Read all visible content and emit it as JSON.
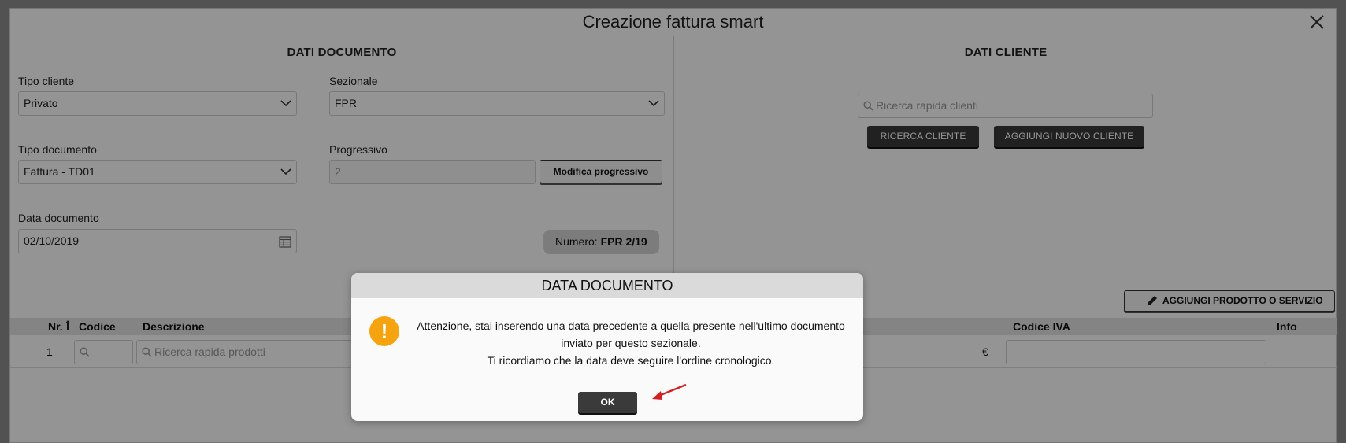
{
  "window": {
    "title": "Creazione fattura smart",
    "close_icon": "close-icon"
  },
  "dati_documento": {
    "title": "DATI DOCUMENTO",
    "tipo_cliente": {
      "label": "Tipo cliente",
      "value": "Privato"
    },
    "sezionale": {
      "label": "Sezionale",
      "value": "FPR"
    },
    "tipo_documento": {
      "label": "Tipo documento",
      "value": "Fattura - TD01"
    },
    "progressivo": {
      "label": "Progressivo",
      "value": "2",
      "button": "Modifica progressivo"
    },
    "data_documento": {
      "label": "Data documento",
      "value": "02/10/2019"
    },
    "numero": {
      "label": "Numero:",
      "value": "FPR 2/19"
    }
  },
  "dati_cliente": {
    "title": "DATI CLIENTE",
    "search_placeholder": "Ricerca rapida clienti",
    "ricerca_button": "RICERCA CLIENTE",
    "aggiungi_button": "AGGIUNGI NUOVO CLIENTE"
  },
  "products": {
    "add_button": "AGGIUNGI PRODOTTO O SERVIZIO",
    "columns": {
      "nr": "Nr.",
      "codice": "Codice",
      "descrizione": "Descrizione",
      "codice_iva": "Codice IVA",
      "info": "Info"
    },
    "rows": [
      {
        "nr": "1",
        "descrizione_placeholder": "Ricerca rapida prodotti",
        "currency": "€"
      }
    ]
  },
  "modal": {
    "title": "DATA DOCUMENTO",
    "message_line1": "Attenzione, stai inserendo una data precedente a quella presente nell'ultimo documento",
    "message_line2": "inviato per questo sezionale.",
    "message_line3": "Ti ricordiamo che la data deve seguire l'ordine cronologico.",
    "ok_label": "OK",
    "warning_symbol": "!"
  },
  "colors": {
    "warning": "#f5a30f",
    "dark_button": "#3a3a3a",
    "annotation_arrow": "#d42020"
  }
}
